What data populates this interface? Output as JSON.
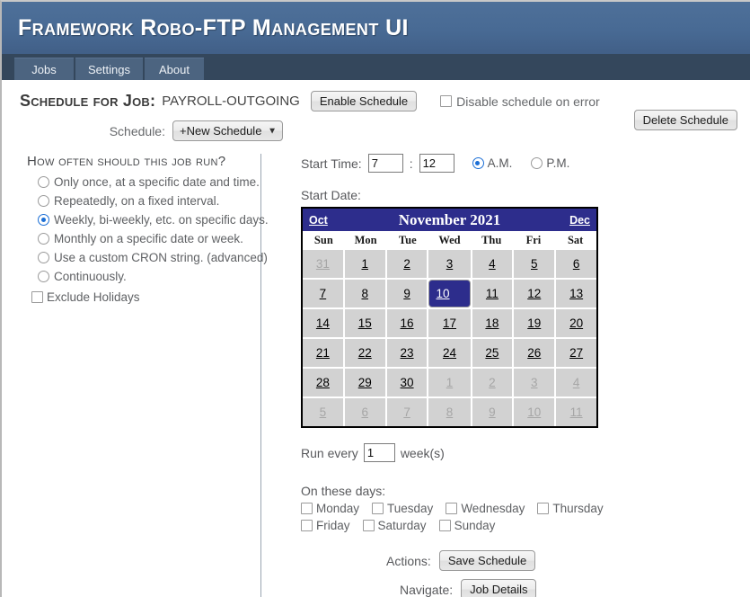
{
  "header": {
    "title": "Framework Robo-FTP Management UI"
  },
  "tabs": [
    {
      "label": "Jobs",
      "active": true
    },
    {
      "label": "Settings",
      "active": false
    },
    {
      "label": "About",
      "active": false
    }
  ],
  "schedule_header": {
    "title": "Schedule for Job:",
    "job_name": "PAYROLL-OUTGOING",
    "enable_button": "Enable Schedule",
    "disable_on_error_label": "Disable schedule on error",
    "disable_on_error_checked": false,
    "schedule_label": "Schedule:",
    "schedule_selected": "+New Schedule",
    "schedule_options": [
      "+New Schedule"
    ],
    "delete_button": "Delete Schedule"
  },
  "frequency": {
    "question": "How often should this job run?",
    "options": [
      {
        "label": "Only once, at a specific date and time.",
        "selected": false
      },
      {
        "label": "Repeatedly, on a fixed interval.",
        "selected": false
      },
      {
        "label": "Weekly, bi-weekly, etc. on specific days.",
        "selected": true
      },
      {
        "label": "Monthly on a specific date or week.",
        "selected": false
      },
      {
        "label": "Use a custom CRON string. (advanced)",
        "selected": false
      },
      {
        "label": "Continuously.",
        "selected": false
      }
    ],
    "exclude_holidays_label": "Exclude Holidays",
    "exclude_holidays_checked": false
  },
  "start_time": {
    "label": "Start Time:",
    "hour": "7",
    "separator": ":",
    "minute": "12",
    "am_label": "A.M.",
    "pm_label": "P.M.",
    "meridiem_selected": "A.M."
  },
  "start_date": {
    "label": "Start Date:",
    "prev_month": "Oct",
    "next_month": "Dec",
    "month_title": "November 2021",
    "day_names": [
      "Sun",
      "Mon",
      "Tue",
      "Wed",
      "Thu",
      "Fri",
      "Sat"
    ],
    "selected_day": 10,
    "cells": [
      {
        "d": "31",
        "other": true
      },
      {
        "d": "1"
      },
      {
        "d": "2"
      },
      {
        "d": "3"
      },
      {
        "d": "4"
      },
      {
        "d": "5"
      },
      {
        "d": "6"
      },
      {
        "d": "7"
      },
      {
        "d": "8"
      },
      {
        "d": "9"
      },
      {
        "d": "10",
        "sel": true
      },
      {
        "d": "11"
      },
      {
        "d": "12"
      },
      {
        "d": "13"
      },
      {
        "d": "14"
      },
      {
        "d": "15"
      },
      {
        "d": "16"
      },
      {
        "d": "17"
      },
      {
        "d": "18"
      },
      {
        "d": "19"
      },
      {
        "d": "20"
      },
      {
        "d": "21"
      },
      {
        "d": "22"
      },
      {
        "d": "23"
      },
      {
        "d": "24"
      },
      {
        "d": "25"
      },
      {
        "d": "26"
      },
      {
        "d": "27"
      },
      {
        "d": "28"
      },
      {
        "d": "29"
      },
      {
        "d": "30"
      },
      {
        "d": "1",
        "other": true
      },
      {
        "d": "2",
        "other": true
      },
      {
        "d": "3",
        "other": true
      },
      {
        "d": "4",
        "other": true
      },
      {
        "d": "5",
        "other": true
      },
      {
        "d": "6",
        "other": true
      },
      {
        "d": "7",
        "other": true
      },
      {
        "d": "8",
        "other": true
      },
      {
        "d": "9",
        "other": true
      },
      {
        "d": "10",
        "other": true
      },
      {
        "d": "11",
        "other": true
      }
    ]
  },
  "recurrence": {
    "run_every_prefix": "Run every",
    "interval_value": "1",
    "run_every_suffix": "week(s)",
    "on_these_days_label": "On these days:",
    "days": [
      {
        "label": "Monday",
        "checked": false
      },
      {
        "label": "Tuesday",
        "checked": false
      },
      {
        "label": "Wednesday",
        "checked": false
      },
      {
        "label": "Thursday",
        "checked": false
      },
      {
        "label": "Friday",
        "checked": false
      },
      {
        "label": "Saturday",
        "checked": false
      },
      {
        "label": "Sunday",
        "checked": false
      }
    ]
  },
  "footer": {
    "actions_label": "Actions:",
    "save_button": "Save Schedule",
    "navigate_label": "Navigate:",
    "job_details_button": "Job Details"
  },
  "colors": {
    "header_blue": "#486a94",
    "tabbar_dark": "#34475c",
    "calendar_navy": "#2d2d8c",
    "radio_accent": "#1c6fd6",
    "cell_grey": "#d2d2d2"
  }
}
